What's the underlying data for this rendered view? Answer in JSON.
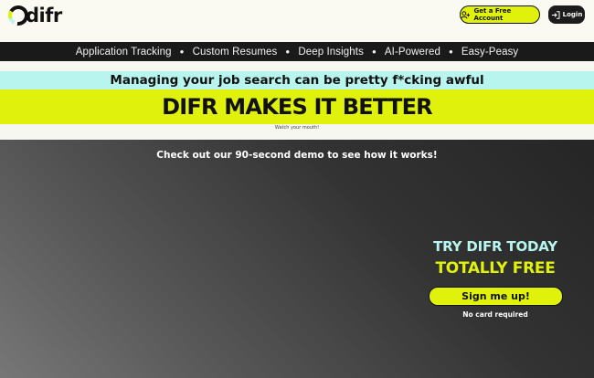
{
  "header": {
    "logo_text": "difr",
    "get_account_label": "Get a Free Account",
    "login_label": "Login"
  },
  "ticker": {
    "items": [
      "Application Tracking",
      "Custom Resumes",
      "Deep Insights",
      "AI-Powered",
      "Easy-Peasy"
    ],
    "separator": "●"
  },
  "hero_banner": {
    "tagline": "Managing your job search can be pretty f*cking awful",
    "headline": "DIFR MAKES IT BETTER",
    "note": "Watch your mouth!"
  },
  "demo": {
    "text": "Check out our 90-second demo to see how it works!"
  },
  "cta": {
    "line1": "TRY DIFR TODAY",
    "line2": "TOTALLY FREE",
    "button_label": "Sign me up!",
    "subtext": "No card required"
  },
  "colors": {
    "accent_lime": "#e0f20c",
    "accent_cyan": "#b8f5ee",
    "dark": "#1a1a1a"
  }
}
